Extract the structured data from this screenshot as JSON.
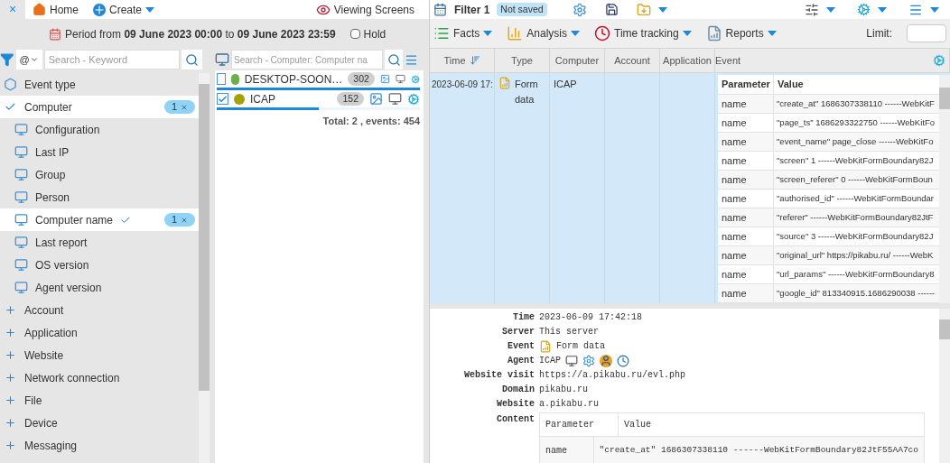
{
  "top_nav": {
    "close": "×",
    "items": [
      {
        "kind": "home",
        "label": "Home"
      },
      {
        "kind": "create",
        "label": "Create"
      }
    ],
    "viewing": "Viewing Screens"
  },
  "period": {
    "label": "Period from",
    "start": "09 June 2023 00:00",
    "joiner": "to",
    "end": "09 June 2023 23:59",
    "hold": {
      "label": "Hold",
      "checked": false
    }
  },
  "filter_search": {
    "mode": "@",
    "placeholder": "Search - Keyword"
  },
  "tree": [
    {
      "kind": "category",
      "label": "Event type",
      "selected": false
    },
    {
      "kind": "group",
      "label": "Computer",
      "selected": true,
      "expanded": true,
      "badge": "1",
      "children": [
        {
          "label": "Configuration",
          "selected": false
        },
        {
          "label": "Last IP",
          "selected": false
        },
        {
          "label": "Group",
          "selected": false
        },
        {
          "label": "Person",
          "selected": false
        },
        {
          "label": "Computer name",
          "selected": true,
          "badge": "1"
        },
        {
          "label": "Last report",
          "selected": false
        },
        {
          "label": "OS version",
          "selected": false
        },
        {
          "label": "Agent version",
          "selected": false
        }
      ]
    },
    {
      "kind": "group",
      "label": "Account",
      "selected": false,
      "expanded": false
    },
    {
      "kind": "group",
      "label": "Application",
      "selected": false,
      "expanded": false
    },
    {
      "kind": "group",
      "label": "Website",
      "selected": false,
      "expanded": false
    },
    {
      "kind": "group",
      "label": "Network connection",
      "selected": false,
      "expanded": false
    },
    {
      "kind": "group",
      "label": "File",
      "selected": false,
      "expanded": false
    },
    {
      "kind": "group",
      "label": "Device",
      "selected": false,
      "expanded": false
    },
    {
      "kind": "group",
      "label": "Messaging",
      "selected": false,
      "expanded": false
    }
  ],
  "computer_search": {
    "placeholder": "Search - Computer: Computer na"
  },
  "computers": [
    {
      "name": "DESKTOP-SOON…",
      "checked": false,
      "color": "#6ab04c",
      "count": "302",
      "level": 1
    },
    {
      "name": "ICAP",
      "checked": true,
      "color": "#a8a000",
      "count": "152",
      "level": 0.5
    }
  ],
  "computer_total": "Total: 2 , events: 454",
  "filter_tab": {
    "title": "Filter 1",
    "status": "Not saved"
  },
  "toolbar": [
    {
      "kind": "facts",
      "label": "Facts"
    },
    {
      "kind": "analysis",
      "label": "Analysis"
    },
    {
      "kind": "time",
      "label": "Time tracking"
    },
    {
      "kind": "reports",
      "label": "Reports"
    }
  ],
  "limit": {
    "label": "Limit:"
  },
  "table": {
    "columns": [
      "Time",
      "Type",
      "Computer",
      "Account",
      "Application",
      "Event"
    ],
    "rows": [
      {
        "selected": true,
        "time": "2023-06-09 17:",
        "type": "Form data",
        "computer": "ICAP",
        "event": {
          "columns": [
            "Parameter",
            "Value"
          ],
          "rows": [
            [
              "name",
              "\"create_at\" 1686307338110 ------WebKitF"
            ],
            [
              "name",
              "\"page_ts\" 1686293322750 ------WebKitFo"
            ],
            [
              "name",
              "\"event_name\" page_close ------WebKitFo"
            ],
            [
              "name",
              "\"screen\" 1 ------WebKitFormBoundary82J"
            ],
            [
              "name",
              "\"screen_referer\" 0 ------WebKitFormBoun"
            ],
            [
              "name",
              "\"authorised_id\" ------WebKitFormBoundar"
            ],
            [
              "name",
              "\"referer\" ------WebKitFormBoundary82JtF"
            ],
            [
              "name",
              "\"source\" 3 ------WebKitFormBoundary82J"
            ],
            [
              "name",
              "\"original_url\" https://pikabu.ru/ ------WebK"
            ],
            [
              "name",
              "\"url_params\" ------WebKitFormBoundary8"
            ],
            [
              "name",
              "\"google_id\" 813340915.1686290038 ------"
            ]
          ]
        }
      }
    ]
  },
  "details": [
    {
      "kind": "text",
      "label": "Time",
      "value": "2023-06-09 17:42:18"
    },
    {
      "kind": "text",
      "label": "Server",
      "value": "This server"
    },
    {
      "kind": "event",
      "label": "Event",
      "value": "Form data"
    },
    {
      "kind": "agent",
      "label": "Agent",
      "value": "ICAP"
    },
    {
      "kind": "text",
      "label": "Website visit",
      "value": "https://a.pikabu.ru/evl.php"
    },
    {
      "kind": "text",
      "label": "Domain",
      "value": "pikabu.ru"
    },
    {
      "kind": "text",
      "label": "Website",
      "value": "a.pikabu.ru"
    }
  ],
  "content": {
    "label": "Content",
    "columns": [
      "Parameter",
      "Value"
    ],
    "rows": [
      [
        "name",
        "\"create_at\" 1686307338110 ------WebKitFormBoundary82JtF55AA7co"
      ]
    ]
  }
}
